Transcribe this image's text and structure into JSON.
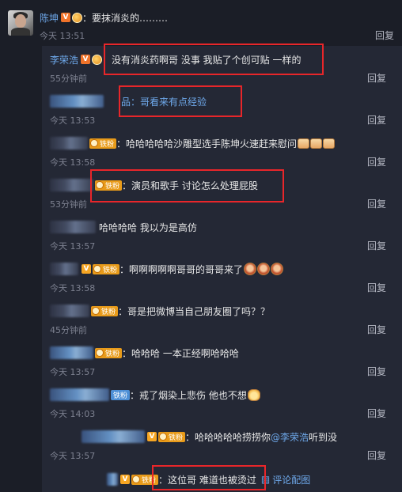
{
  "top": {
    "username": "陈坤",
    "text": "：要抹消炎的………",
    "time": "今天 13:51",
    "reply": "回复"
  },
  "replies": [
    {
      "username": "李荣浩",
      "text": "：没有消炎药啊哥 没事 我贴了个创可贴 一样的",
      "time": "55分钟前",
      "reply": "回复"
    },
    {
      "username": "",
      "text": "品：哥看来有点经验",
      "time": "今天 13:53",
      "reply": "回复"
    },
    {
      "username": "",
      "badge": "铁粉",
      "text": "：哈哈哈哈哈沙雕型选手陈坤火速赶来慰问",
      "time": "今天 13:58",
      "reply": "回复"
    },
    {
      "username": "",
      "badge": "铁粉",
      "text": "：演员和歌手 讨论怎么处理屁股",
      "time": "53分钟前",
      "reply": "回复"
    },
    {
      "username": "",
      "text": "哈哈哈哈 我以为是高仿",
      "time": "今天 13:57",
      "reply": "回复"
    },
    {
      "username": "",
      "badge": "铁粉",
      "text": "：啊啊啊啊啊哥哥的哥哥来了",
      "time": "今天 13:58",
      "reply": "回复"
    },
    {
      "username": "",
      "badge": "铁粉",
      "text": "：哥是把微博当自己朋友圈了吗？？",
      "time": "45分钟前",
      "reply": "回复"
    },
    {
      "username": "",
      "badge": "铁粉",
      "text": "：哈哈哈  一本正经啊哈哈哈",
      "time": "今天 13:57",
      "reply": "回复"
    },
    {
      "username": "",
      "badge": "铁粉",
      "text": "：戒了烟染上悲伤 他也不想",
      "time": "今天 14:03",
      "reply": "回复"
    },
    {
      "username": "",
      "badge": "铁粉",
      "text": "：哈哈哈哈哈捞捞你 ",
      "mention": "@李荣浩",
      "text2": " 听到没",
      "time": "今天 13:57",
      "reply": "回复"
    },
    {
      "username": "",
      "badge": "铁粉",
      "text": "：这位哥 难道也被烫过",
      "pic_link": "评论配图"
    }
  ],
  "icons": {
    "verified": "verified-v-icon",
    "medal": "medal-icon",
    "picture": "picture-icon"
  },
  "colors": {
    "background": "#1b1e27",
    "reply_panel": "#242835",
    "link": "#6ea8ea",
    "highlight": "#e8262a"
  }
}
